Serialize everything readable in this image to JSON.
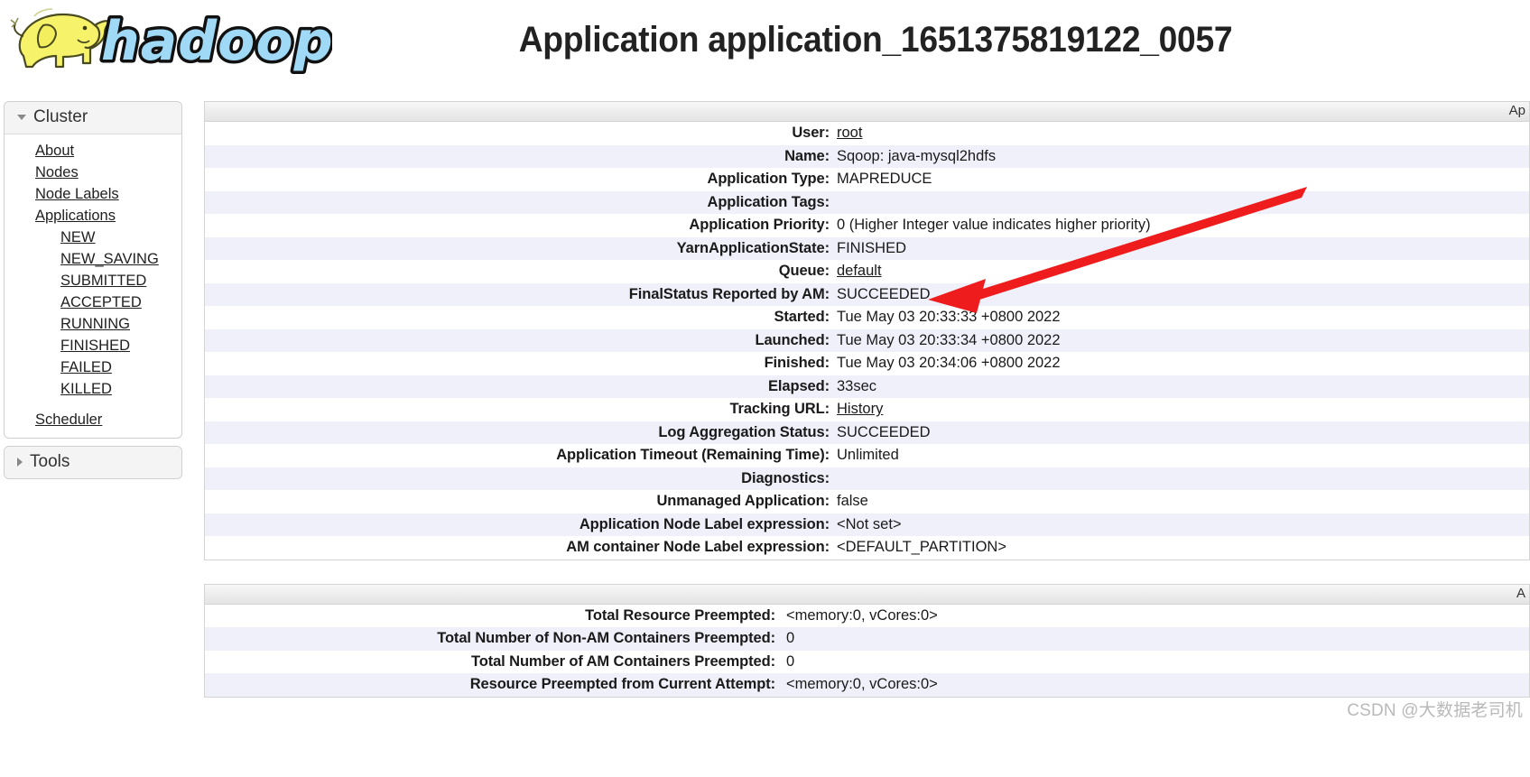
{
  "header": {
    "logo_alt": "hadoop-logo",
    "title": "Application application_1651375819122_0057"
  },
  "sidebar": {
    "cluster": {
      "label": "Cluster",
      "expanded": true,
      "items": [
        {
          "label": "About"
        },
        {
          "label": "Nodes"
        },
        {
          "label": "Node Labels"
        },
        {
          "label": "Applications"
        }
      ],
      "application_states": [
        {
          "label": "NEW"
        },
        {
          "label": "NEW_SAVING"
        },
        {
          "label": "SUBMITTED"
        },
        {
          "label": "ACCEPTED"
        },
        {
          "label": "RUNNING"
        },
        {
          "label": "FINISHED"
        },
        {
          "label": "FAILED"
        },
        {
          "label": "KILLED"
        }
      ],
      "scheduler": {
        "label": "Scheduler"
      }
    },
    "tools": {
      "label": "Tools",
      "expanded": false
    }
  },
  "main": {
    "overview_table": {
      "caption": "Ap",
      "rows": [
        {
          "label": "User:",
          "value": "root",
          "link": true
        },
        {
          "label": "Name:",
          "value": "Sqoop: java-mysql2hdfs",
          "link": false
        },
        {
          "label": "Application Type:",
          "value": "MAPREDUCE",
          "link": false
        },
        {
          "label": "Application Tags:",
          "value": "",
          "link": false
        },
        {
          "label": "Application Priority:",
          "value": "0 (Higher Integer value indicates higher priority)",
          "link": false
        },
        {
          "label": "YarnApplicationState:",
          "value": "FINISHED",
          "link": false
        },
        {
          "label": "Queue:",
          "value": "default",
          "link": true
        },
        {
          "label": "FinalStatus Reported by AM:",
          "value": "SUCCEEDED",
          "link": false
        },
        {
          "label": "Started:",
          "value": "Tue May 03 20:33:33 +0800 2022",
          "link": false
        },
        {
          "label": "Launched:",
          "value": "Tue May 03 20:33:34 +0800 2022",
          "link": false
        },
        {
          "label": "Finished:",
          "value": "Tue May 03 20:34:06 +0800 2022",
          "link": false
        },
        {
          "label": "Elapsed:",
          "value": "33sec",
          "link": false
        },
        {
          "label": "Tracking URL:",
          "value": "History",
          "link": true
        },
        {
          "label": "Log Aggregation Status:",
          "value": "SUCCEEDED",
          "link": false
        },
        {
          "label": "Application Timeout (Remaining Time):",
          "value": "Unlimited",
          "link": false
        },
        {
          "label": "Diagnostics:",
          "value": "",
          "link": false
        },
        {
          "label": "Unmanaged Application:",
          "value": "false",
          "link": false
        },
        {
          "label": "Application Node Label expression:",
          "value": "<Not set>",
          "link": false
        },
        {
          "label": "AM container Node Label expression:",
          "value": "<DEFAULT_PARTITION>",
          "link": false
        }
      ]
    },
    "preemption_table": {
      "caption": "A",
      "rows": [
        {
          "label": "Total Resource Preempted:",
          "value": "<memory:0, vCores:0>",
          "link": false
        },
        {
          "label": "Total Number of Non-AM Containers Preempted:",
          "value": "0",
          "link": false
        },
        {
          "label": "Total Number of AM Containers Preempted:",
          "value": "0",
          "link": false
        },
        {
          "label": "Resource Preempted from Current Attempt:",
          "value": "<memory:0, vCores:0>",
          "link": false
        }
      ]
    }
  },
  "annotation": {
    "arrow_color": "#ee1c1c",
    "arrow_target": "SUCCEEDED"
  },
  "watermark": {
    "text": "CSDN @大数据老司机"
  },
  "colors": {
    "row_even": "#f0f0fa",
    "row_odd": "#ffffff",
    "panel_head": "#f4f4f4",
    "logo_elephant": "#f6f36a",
    "logo_text": "#9fd9f6",
    "accent_red": "#ee1c1c"
  }
}
